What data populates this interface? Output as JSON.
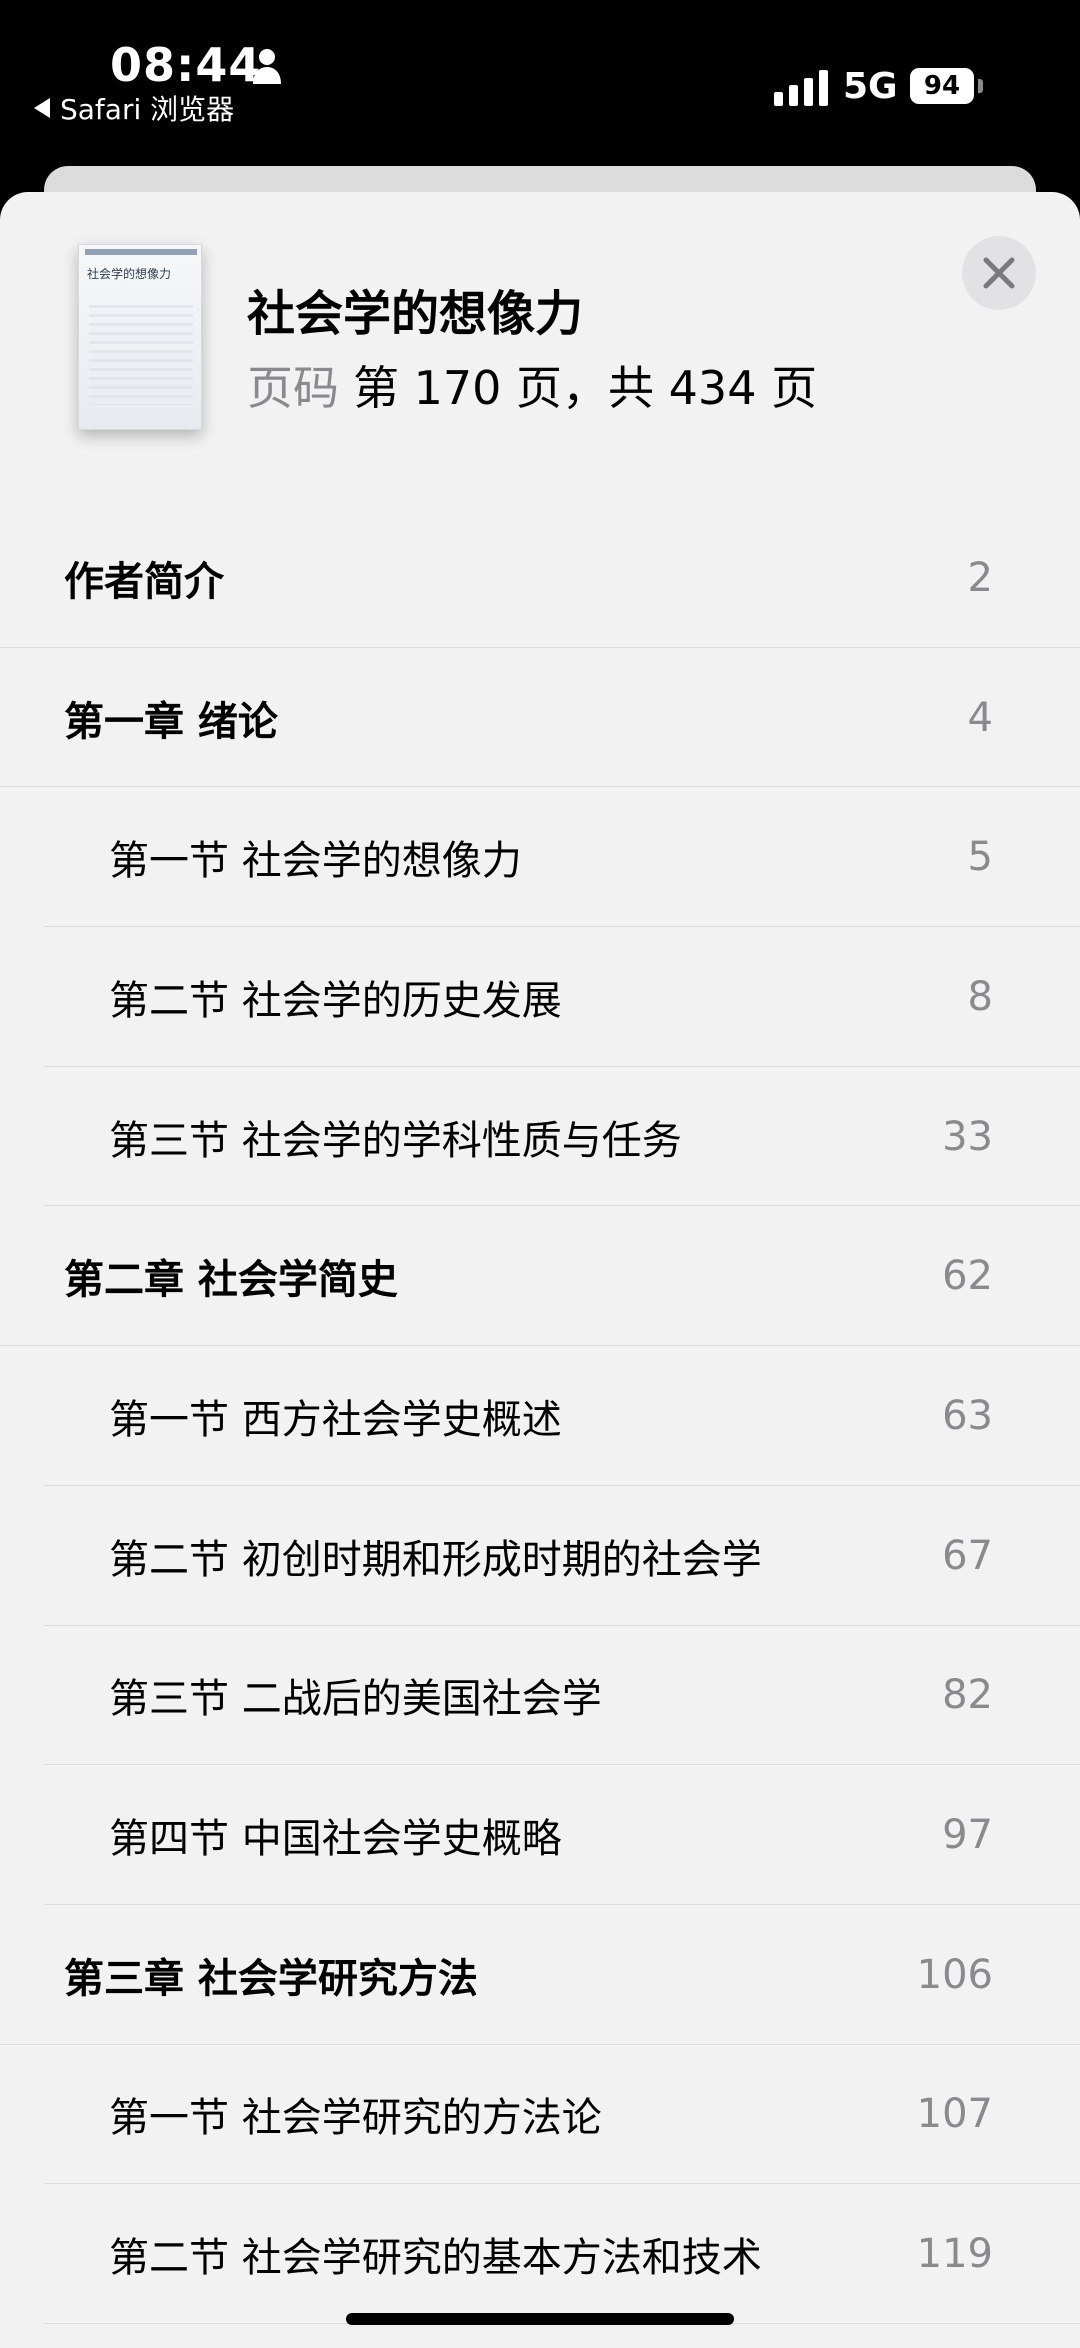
{
  "status_bar": {
    "time": "08:44",
    "back_app": "Safari 浏览器",
    "network": "5G",
    "battery": "94"
  },
  "book": {
    "title": "社会学的想像力",
    "cover_title": "社会学的想像力",
    "page_label": "页码",
    "page_value": "第 170 页，共 434 页"
  },
  "toc": [
    {
      "label": "作者简介",
      "page": "2",
      "level": "chapter"
    },
    {
      "label": "第一章 绪论",
      "page": "4",
      "level": "chapter"
    },
    {
      "label": "第一节 社会学的想像力",
      "page": "5",
      "level": "section"
    },
    {
      "label": "第二节 社会学的历史发展",
      "page": "8",
      "level": "section"
    },
    {
      "label": "第三节 社会学的学科性质与任务",
      "page": "33",
      "level": "section"
    },
    {
      "label": "第二章 社会学简史",
      "page": "62",
      "level": "chapter"
    },
    {
      "label": "第一节 西方社会学史概述",
      "page": "63",
      "level": "section"
    },
    {
      "label": "第二节 初创时期和形成时期的社会学",
      "page": "67",
      "level": "section"
    },
    {
      "label": "第三节 二战后的美国社会学",
      "page": "82",
      "level": "section"
    },
    {
      "label": "第四节 中国社会学史概略",
      "page": "97",
      "level": "section"
    },
    {
      "label": "第三章 社会学研究方法",
      "page": "106",
      "level": "chapter"
    },
    {
      "label": "第一节 社会学研究的方法论",
      "page": "107",
      "level": "section"
    },
    {
      "label": "第二节 社会学研究的基本方法和技术",
      "page": "119",
      "level": "section"
    }
  ]
}
